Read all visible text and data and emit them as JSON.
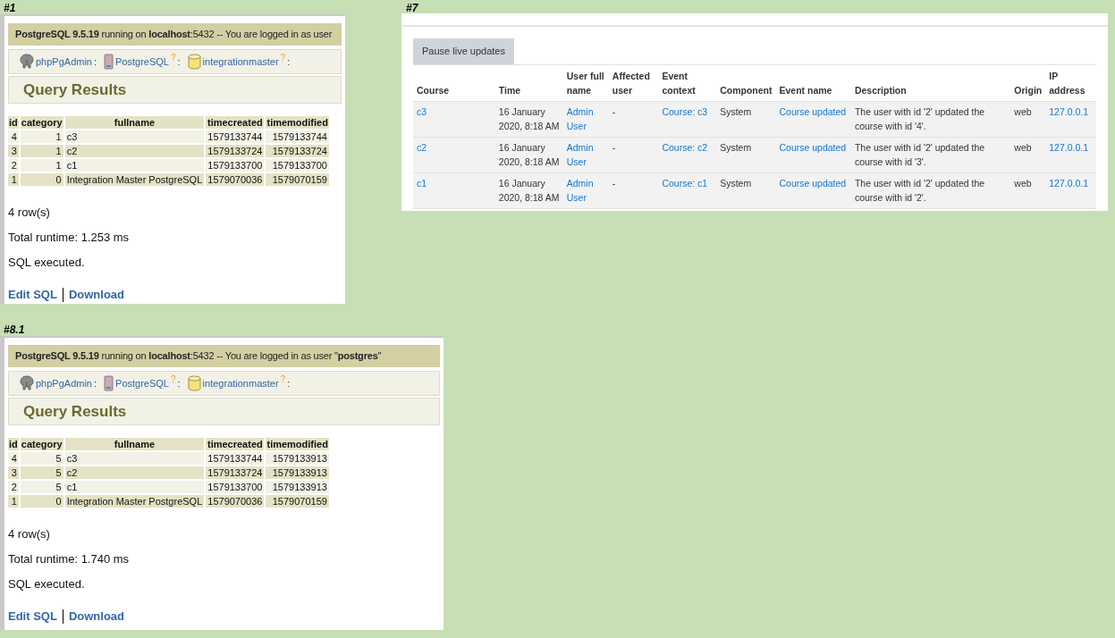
{
  "panels": [
    {
      "kind": "pgadmin",
      "label": "#1",
      "server_bar": "**PostgreSQL 9.5.19** running on **localhost**:5432 -- You are logged in as user",
      "breadcrumb": [
        {
          "label": "phpPgAdmin",
          "separator": ":"
        },
        {
          "label": "PostgreSQL",
          "help": "?",
          "separator": ":"
        },
        {
          "label": "integrationmaster",
          "help": "?",
          "separator": ":"
        }
      ],
      "heading": "Query Results",
      "columns": [
        "id",
        "category",
        "fullname",
        "timecreated",
        "timemodified"
      ],
      "rows": [
        [
          "4",
          "1",
          "c3",
          "1579133744",
          "1579133744"
        ],
        [
          "3",
          "1",
          "c2",
          "1579133724",
          "1579133724"
        ],
        [
          "2",
          "1",
          "c1",
          "1579133700",
          "1579133700"
        ],
        [
          "1",
          "0",
          "Integration Master PostgreSQL",
          "1579070036",
          "1579070159"
        ]
      ],
      "messages": [
        "4 row(s)",
        "Total runtime: 1.253 ms",
        "SQL executed."
      ],
      "links": [
        "Edit SQL",
        "Download"
      ]
    },
    {
      "kind": "moodle_log",
      "label": "#7",
      "button": "Pause live updates",
      "columns": [
        {
          "label": "Course",
          "kind": "link"
        },
        {
          "label": "Time",
          "kind": "text"
        },
        {
          "label": "User full name",
          "kind": "link"
        },
        {
          "label": "Affected user",
          "kind": "text"
        },
        {
          "label": "Event context",
          "kind": "link"
        },
        {
          "label": "Component",
          "kind": "text"
        },
        {
          "label": "Event name",
          "kind": "link"
        },
        {
          "label": "Description",
          "kind": "text"
        },
        {
          "label": "Origin",
          "kind": "text"
        },
        {
          "label": "IP address",
          "kind": "link"
        }
      ],
      "rows": [
        [
          "c3",
          "16 January 2020, 8:18 AM",
          "Admin User",
          "-",
          "Course: c3",
          "System",
          "Course updated",
          "The user with id '2' updated the course with id '4'.",
          "web",
          "127.0.0.1"
        ],
        [
          "c2",
          "16 January 2020, 8:18 AM",
          "Admin User",
          "-",
          "Course: c2",
          "System",
          "Course updated",
          "The user with id '2' updated the course with id '3'.",
          "web",
          "127.0.0.1"
        ],
        [
          "c1",
          "16 January 2020, 8:18 AM",
          "Admin User",
          "-",
          "Course: c1",
          "System",
          "Course updated",
          "The user with id '2' updated the course with id '2'.",
          "web",
          "127.0.0.1"
        ]
      ]
    },
    {
      "kind": "pgadmin",
      "label": "#8.1",
      "server_bar": "**PostgreSQL 9.5.19** running on **localhost**:5432 -- You are logged in as user \"**postgres**\"",
      "breadcrumb": [
        {
          "label": "phpPgAdmin",
          "separator": ":"
        },
        {
          "label": "PostgreSQL",
          "help": "?",
          "separator": ":"
        },
        {
          "label": "integrationmaster",
          "help": "?",
          "separator": ":"
        }
      ],
      "heading": "Query Results",
      "columns": [
        "id",
        "category",
        "fullname",
        "timecreated",
        "timemodified"
      ],
      "rows": [
        [
          "4",
          "5",
          "c3",
          "1579133744",
          "1579133913"
        ],
        [
          "3",
          "5",
          "c2",
          "1579133724",
          "1579133913"
        ],
        [
          "2",
          "5",
          "c1",
          "1579133700",
          "1579133913"
        ],
        [
          "1",
          "0",
          "Integration Master PostgreSQL",
          "1579070036",
          "1579070159"
        ]
      ],
      "messages": [
        "4 row(s)",
        "Total runtime: 1.740 ms",
        "SQL executed."
      ],
      "links": [
        "Edit SQL",
        "Download"
      ]
    }
  ]
}
